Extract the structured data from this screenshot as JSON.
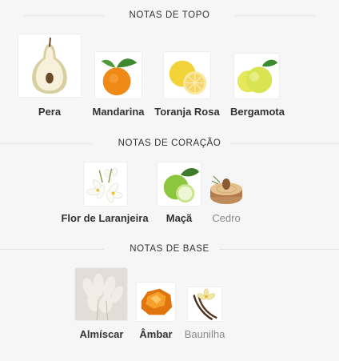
{
  "sections": [
    {
      "title": "NOTAS DE TOPO",
      "notes": [
        {
          "label": "Pera",
          "icon": "pear-icon"
        },
        {
          "label": "Mandarina",
          "icon": "mandarin-icon"
        },
        {
          "label": "Toranja Rosa",
          "icon": "grapefruit-icon"
        },
        {
          "label": "Bergamota",
          "icon": "bergamot-icon"
        }
      ]
    },
    {
      "title": "NOTAS DE CORAÇÃO",
      "notes": [
        {
          "label": "Flor de Laranjeira",
          "icon": "orange-blossom-icon"
        },
        {
          "label": "Maçã",
          "icon": "apple-icon"
        },
        {
          "label": "Cedro",
          "icon": "cedar-icon"
        }
      ]
    },
    {
      "title": "NOTAS DE BASE",
      "notes": [
        {
          "label": "Almíscar",
          "icon": "musk-icon"
        },
        {
          "label": "Âmbar",
          "icon": "amber-icon"
        },
        {
          "label": "Baunilha",
          "icon": "vanilla-icon"
        }
      ]
    }
  ]
}
